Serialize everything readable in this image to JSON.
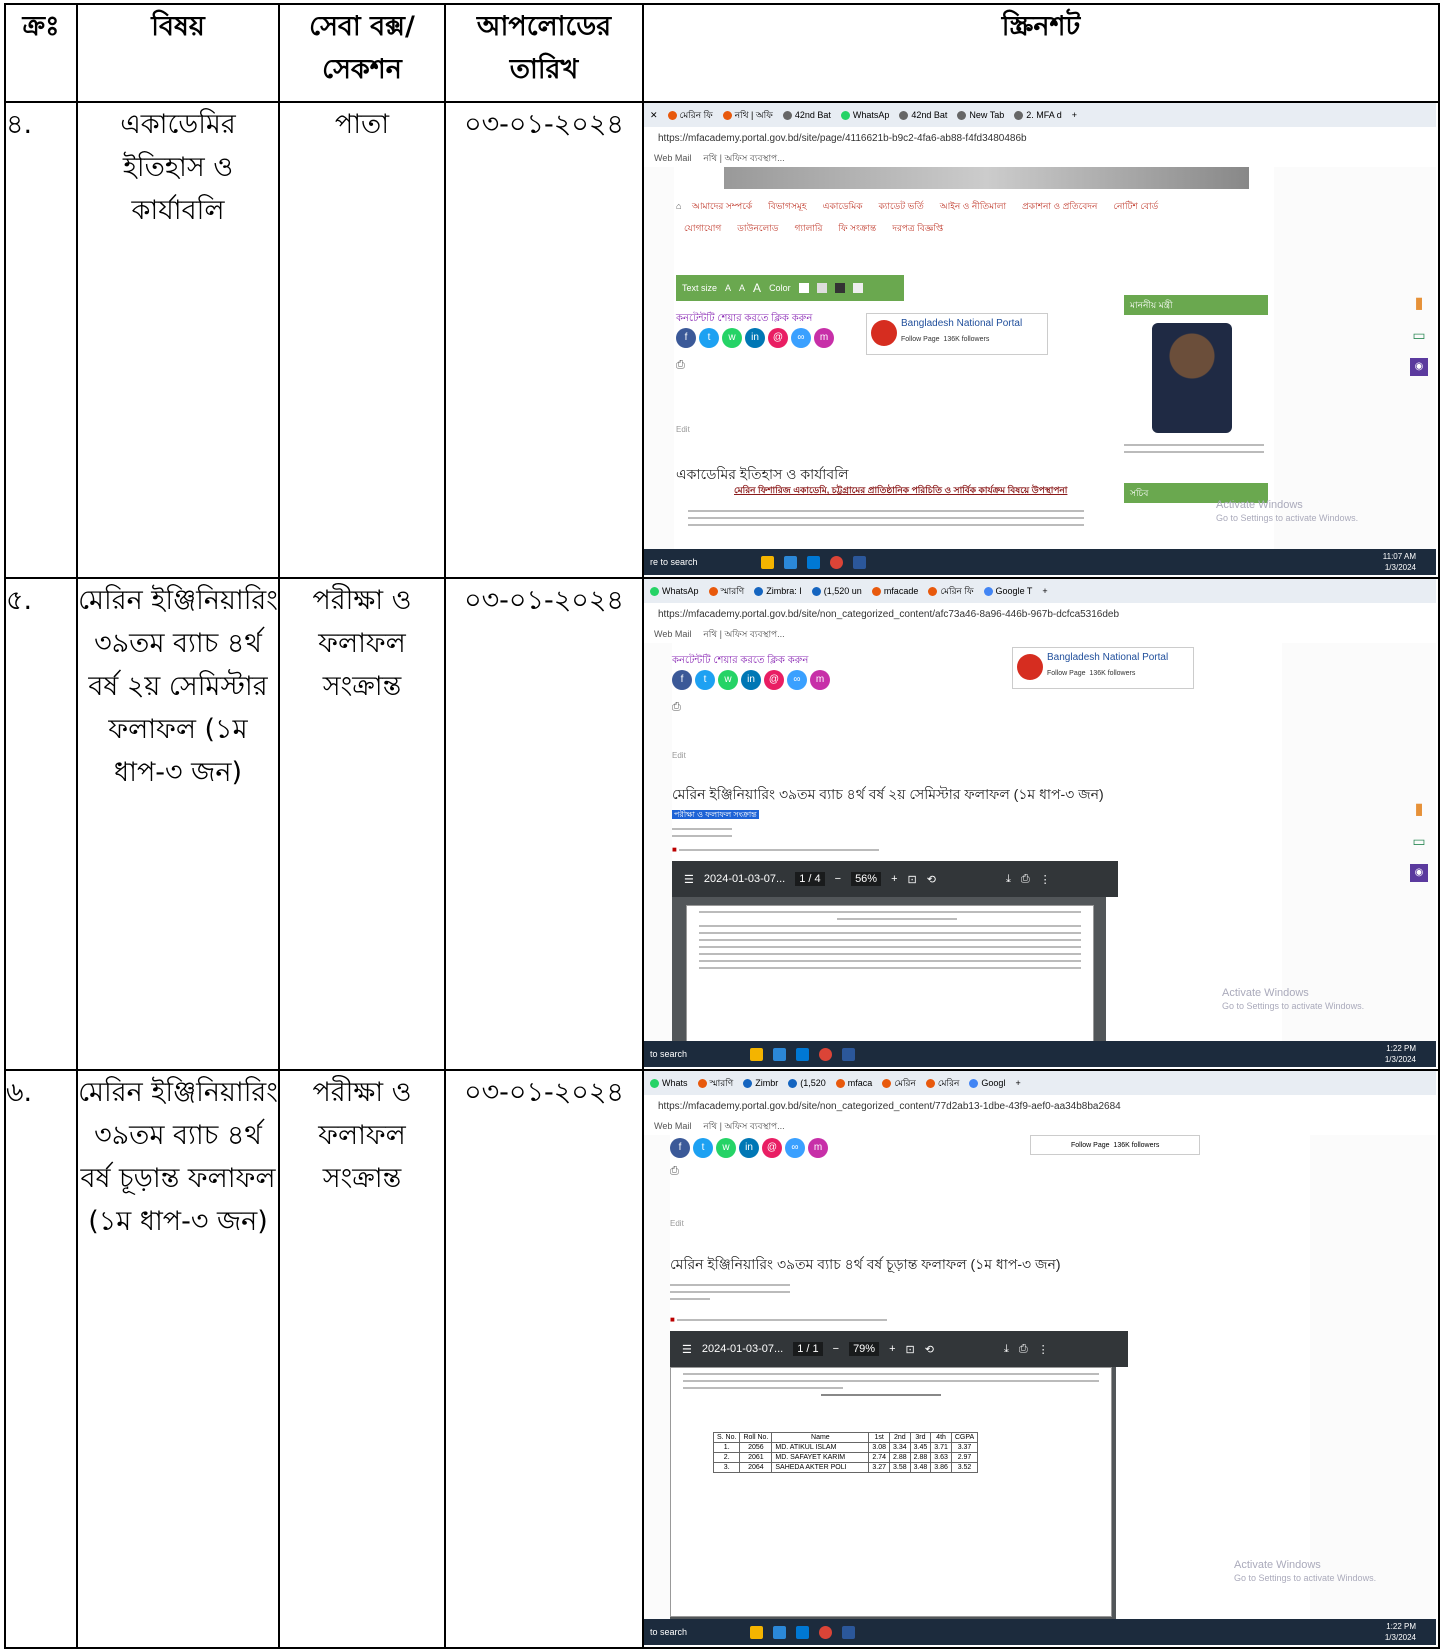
{
  "header": {
    "sl": "ক্রঃ",
    "subject": "বিষয়",
    "section": "সেবা বক্স/ সেকশন",
    "date": "আপলোডের তারিখ",
    "screenshot": "স্ক্রিনশট"
  },
  "rows": [
    {
      "sl": "৪.",
      "subject": "একাডেমির ইতিহাস ও কার্যাবলি",
      "section": "পাতা",
      "date": "০৩-০১-২০২৪",
      "shot": {
        "tabs": [
          "মেরিন ফি",
          "নথি | অফি",
          "42nd Bat",
          "WhatsAp",
          "42nd Bat",
          "New Tab",
          "2. MFA d"
        ],
        "url": "https://mfacademy.portal.gov.bd/site/page/4116621b-b9c2-4fa6-ab88-f4fd3480486b",
        "bookmarks": [
          "Web Mail",
          "নথি | অফিস ব্যবস্থাপ..."
        ],
        "menu": [
          "আমাদের সম্পর্কে",
          "বিভাগসমূহ",
          "একাডেমিক",
          "ক্যাডেট ভর্তি",
          "আইন ও নীতিমালা",
          "প্রকাশনা ও প্রতিবেদন",
          "নোটিশ বোর্ড",
          "যোগাযোগ",
          "ডাউনলোড",
          "গ্যালারি",
          "ফি সংক্রান্ত",
          "দরপত্র বিজ্ঞপ্তি"
        ],
        "textsize": "Text size",
        "color_label": "Color",
        "share": "কনটেন্টটি শেয়ার করতে ক্লিক করুন",
        "portal": "Bangladesh National Portal",
        "follow": "Follow Page",
        "followers": "136K followers",
        "page_title": "একাডেমির ইতিহাস ও কার্যাবলি",
        "sub_title": "মেরিন ফিশারিজ একাডেমি, চট্টগ্রামের প্রাতিষ্ঠানিক পরিচিতি ও সার্বিক কার্যক্রম বিষয়ে উপস্থাপনা",
        "minister_label": "মাননীয় মন্ত্রী",
        "secretary_label": "সচিব",
        "edit": "Edit",
        "windows": "Activate Windows",
        "windows_sub": "Go to Settings to activate Windows.",
        "search": "re to search",
        "time": "11:07 AM",
        "date": "1/3/2024"
      }
    },
    {
      "sl": "৫.",
      "subject": "মেরিন ইঞ্জিনিয়ারিং ৩৯তম ব্যাচ ৪র্থ বর্ষ ২য় সেমিস্টার ফলাফল (১ম ধাপ-৩ জন)",
      "section": "পরীক্ষা ও ফলাফল সংক্রান্ত",
      "date": "০৩-০১-২০২৪",
      "shot": {
        "tabs": [
          "WhatsAp",
          "স্মারণি",
          "Zimbra: I",
          "(1,520 un",
          "mfacade",
          "মেরিন ফি",
          "Google T"
        ],
        "url": "https://mfacademy.portal.gov.bd/site/non_categorized_content/afc73a46-8a96-446b-967b-dcfca5316deb",
        "bookmarks": [
          "Web Mail",
          "নথি | অফিস ব্যবস্থাপ..."
        ],
        "share": "কনটেন্টটি শেয়ার করতে ক্লিক করুন",
        "portal": "Bangladesh National Portal",
        "follow": "Follow Page",
        "followers": "136K followers",
        "edit": "Edit",
        "page_title": "মেরিন ইঞ্জিনিয়ারিং ৩৯তম ব্যাচ ৪র্থ বর্ষ ২য় সেমিস্টার ফলাফল (১ম ধাপ-৩ জন)",
        "service_box": "পরীক্ষা ও ফলাফল সংক্রান্ত",
        "pdf_name": "2024-01-03-07...",
        "pdf_page": "1 / 4",
        "pdf_zoom": "56%",
        "windows": "Activate Windows",
        "windows_sub": "Go to Settings to activate Windows.",
        "search": "to search",
        "time": "1:22 PM",
        "date": "1/3/2024"
      }
    },
    {
      "sl": "৬.",
      "subject": "মেরিন ইঞ্জিনিয়ারিং ৩৯তম ব্যাচ ৪র্থ বর্ষ চূড়ান্ত ফলাফল (১ম ধাপ-৩ জন)",
      "section": "পরীক্ষা ও ফলাফল সংক্রান্ত",
      "date": "০৩-০১-২০২৪",
      "shot": {
        "tabs": [
          "Whats",
          "স্মারণি",
          "Zimbr",
          "(1,520",
          "mfaca",
          "মেরিন",
          "মেরিন",
          "Googl"
        ],
        "url": "https://mfacademy.portal.gov.bd/site/non_categorized_content/77d2ab13-1dbe-43f9-aef0-aa34b8ba2684",
        "bookmarks": [
          "Web Mail",
          "নথি | অফিস ব্যবস্থাপ..."
        ],
        "follow": "Follow Page",
        "followers": "136K followers",
        "edit": "Edit",
        "page_title": "মেরিন ইঞ্জিনিয়ারিং ৩৯তম ব্যাচ ৪র্থ বর্ষ চূড়ান্ত ফলাফল (১ম ধাপ-৩ জন)",
        "pdf_name": "2024-01-03-07...",
        "pdf_page": "1 / 1",
        "pdf_zoom": "79%",
        "table_head": [
          "S. No.",
          "Roll No.",
          "Name",
          "CGPA"
        ],
        "table_rows": [
          [
            "1.",
            "2056",
            "MD. ATIKUL ISLAM",
            "3.08",
            "3.34",
            "3.45",
            "3.71",
            "3.37"
          ],
          [
            "2.",
            "2061",
            "MD. SAFAYET KARIM",
            "2.74",
            "2.88",
            "2.88",
            "3.63",
            "2.97"
          ],
          [
            "3.",
            "2064",
            "SAHEDA AKTER POLI",
            "3.27",
            "3.58",
            "3.48",
            "3.86",
            "3.52"
          ]
        ],
        "windows": "Activate Windows",
        "windows_sub": "Go to Settings to activate Windows.",
        "search": "to search",
        "time": "1:22 PM",
        "date": "1/3/2024"
      }
    }
  ]
}
